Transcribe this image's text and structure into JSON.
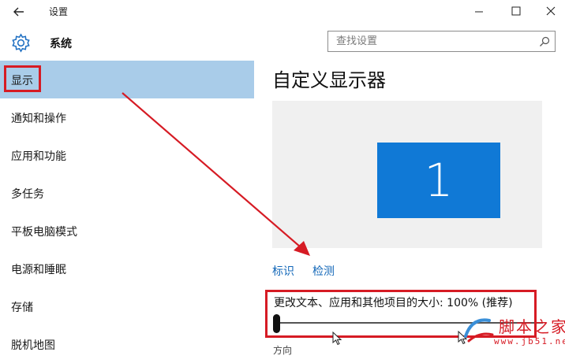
{
  "window": {
    "title": "设置",
    "icons": {
      "back": "back-arrow-icon",
      "minimize": "minimize-icon",
      "maximize": "maximize-icon",
      "close": "close-icon"
    }
  },
  "header": {
    "section_title": "系统",
    "section_icon": "gear-icon",
    "search_placeholder": "查找设置",
    "search_icon": "search-icon"
  },
  "sidebar": {
    "items": [
      {
        "label": "显示",
        "selected": true
      },
      {
        "label": "通知和操作",
        "selected": false
      },
      {
        "label": "应用和功能",
        "selected": false
      },
      {
        "label": "多任务",
        "selected": false
      },
      {
        "label": "平板电脑模式",
        "selected": false
      },
      {
        "label": "电源和睡眠",
        "selected": false
      },
      {
        "label": "存储",
        "selected": false
      },
      {
        "label": "脱机地图",
        "selected": false
      }
    ]
  },
  "main": {
    "title": "自定义显示器",
    "monitor_label": "1",
    "links": {
      "identify": "标识",
      "detect": "检测"
    },
    "scale_label": "更改文本、应用和其他项目的大小: 100% (推荐)",
    "scale_value_percent": 100,
    "cutoff_text": "方向"
  },
  "watermark": {
    "text": "脚本之家",
    "url": "www.jb51.net"
  },
  "colors": {
    "selected_bg": "#a9cce9",
    "accent_blue": "#1079d6",
    "link_blue": "#1267b8",
    "annotation_red": "#d61b24"
  }
}
